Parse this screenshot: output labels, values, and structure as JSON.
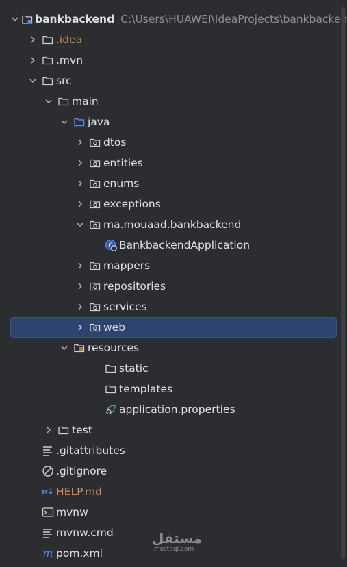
{
  "project": {
    "name": "bankbackend",
    "path": "C:\\Users\\HUAWEI\\IdeaProjects\\bankbackend"
  },
  "tree": {
    "idea": ".idea",
    "mvn": ".mvn",
    "src": "src",
    "main": "main",
    "java": "java",
    "dtos": "dtos",
    "entities": "entities",
    "enums": "enums",
    "exceptions": "exceptions",
    "package": "ma.mouaad.bankbackend",
    "app_class": "BankbackendApplication",
    "mappers": "mappers",
    "repositories": "repositories",
    "services": "services",
    "web": "web",
    "resources": "resources",
    "static": "static",
    "templates": "templates",
    "app_props": "application.properties",
    "test": "test",
    "gitattributes": ".gitattributes",
    "gitignore": ".gitignore",
    "help": "HELP.md",
    "mvnw": "mvnw",
    "mvnw_cmd": "mvnw.cmd",
    "pom": "pom.xml"
  },
  "selected_item": "web",
  "watermark": {
    "logo": "مستقل",
    "sub": "mostaql.com"
  },
  "colors": {
    "background": "#2b2d30",
    "selection": "#2e436e",
    "ignored_text": "#d5895d",
    "path_text": "#8c8f94"
  }
}
